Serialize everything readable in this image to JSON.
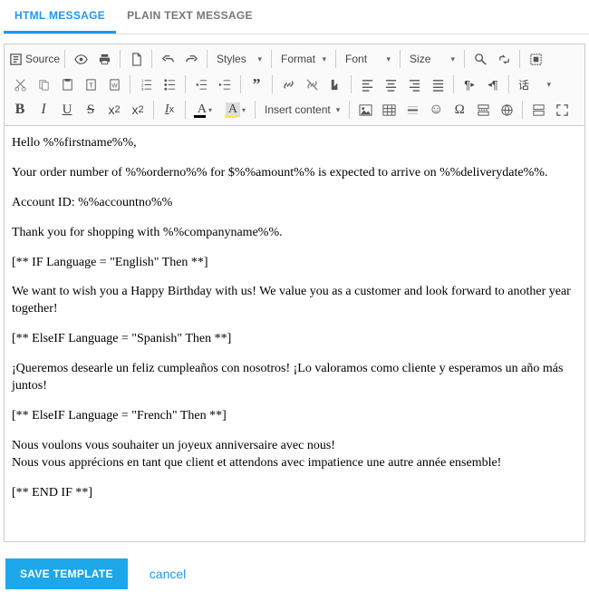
{
  "tabs": {
    "html": "HTML MESSAGE",
    "plain": "PLAIN TEXT MESSAGE"
  },
  "toolbar": {
    "source": "Source",
    "styles": "Styles",
    "format": "Format",
    "font": "Font",
    "size": "Size",
    "insert_content": "Insert content",
    "special_dropdown": "话"
  },
  "bold": "B",
  "italic": "I",
  "underline": "U",
  "strike": "S",
  "sub_x": "x",
  "sub_2": "2",
  "sup_x": "x",
  "sup_2": "2",
  "remove_fmt_i": "I",
  "remove_fmt_x": "x",
  "txtcolor_A": "A",
  "bgcolor_A": "A",
  "omega": "Ω",
  "smiley": "☺",
  "pilcrow": "¶",
  "content": {
    "line1": "Hello %%firstname%%,",
    "line2": "Your order number of %%orderno%% for $%%amount%% is expected to arrive on %%deliverydate%%.",
    "line3": "Account ID: %%accountno%%",
    "line4": "Thank you for shopping with %%companyname%%.",
    "line5": "[** IF Language = \"English\" Then **]",
    "line6": "We want to wish you a Happy Birthday with us! We value you as a customer and look forward to another year together!",
    "line7": "[** ElseIF Language = \"Spanish\" Then **]",
    "line8": "¡Queremos desearle un feliz cumpleaños con nosotros! ¡Lo valoramos como cliente y esperamos un año más juntos!",
    "line9": "[** ElseIF Language = \"French\" Then **]",
    "line10a": "Nous voulons vous souhaiter un joyeux anniversaire avec nous!",
    "line10b": "Nous vous apprécions en tant que client et attendons avec impatience une autre année ensemble!",
    "line11": "[** END IF **]"
  },
  "actions": {
    "save": "SAVE TEMPLATE",
    "cancel": "cancel"
  }
}
